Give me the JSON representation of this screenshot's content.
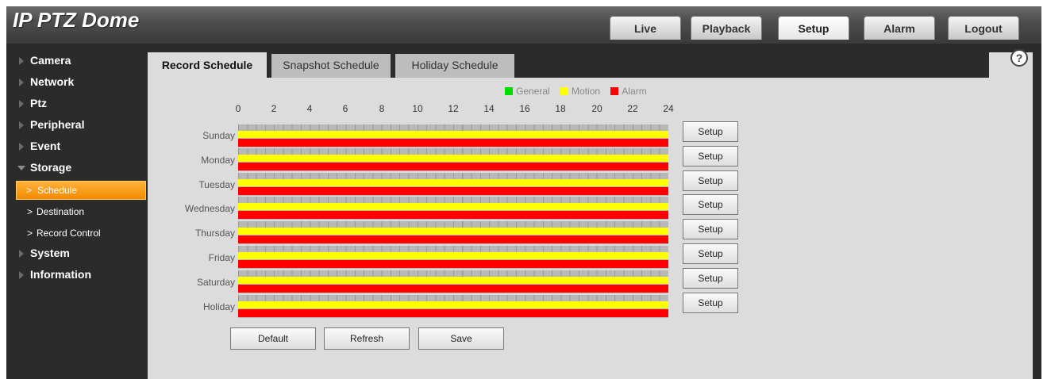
{
  "app": {
    "title": "IP PTZ Dome"
  },
  "nav": {
    "tabs": [
      "Live",
      "Playback",
      "Setup",
      "Alarm",
      "Logout"
    ],
    "active": "Setup"
  },
  "sidebar": {
    "items": [
      "Camera",
      "Network",
      "Ptz",
      "Peripheral",
      "Event",
      "Storage"
    ],
    "sub_items": [
      "Schedule",
      "Destination",
      "Record Control"
    ],
    "active_sub": "Schedule",
    "items_after": [
      "System",
      "Information"
    ]
  },
  "content": {
    "tabs": [
      "Record Schedule",
      "Snapshot Schedule",
      "Holiday Schedule"
    ],
    "active_tab": "Record Schedule",
    "legend": [
      {
        "label": "General",
        "color": "#00dd00"
      },
      {
        "label": "Motion",
        "color": "#ffff00"
      },
      {
        "label": "Alarm",
        "color": "#ff0000"
      }
    ],
    "hours": [
      "0",
      "2",
      "4",
      "6",
      "8",
      "10",
      "12",
      "14",
      "16",
      "18",
      "20",
      "22",
      "24"
    ],
    "days": [
      "Sunday",
      "Monday",
      "Tuesday",
      "Wednesday",
      "Thursday",
      "Friday",
      "Saturday",
      "Holiday"
    ],
    "setup_label": "Setup",
    "buttons": {
      "default": "Default",
      "refresh": "Refresh",
      "save": "Save"
    }
  },
  "colors": {
    "accent": "#f28a00",
    "motion": "#ffff00",
    "alarm": "#ff0000"
  }
}
